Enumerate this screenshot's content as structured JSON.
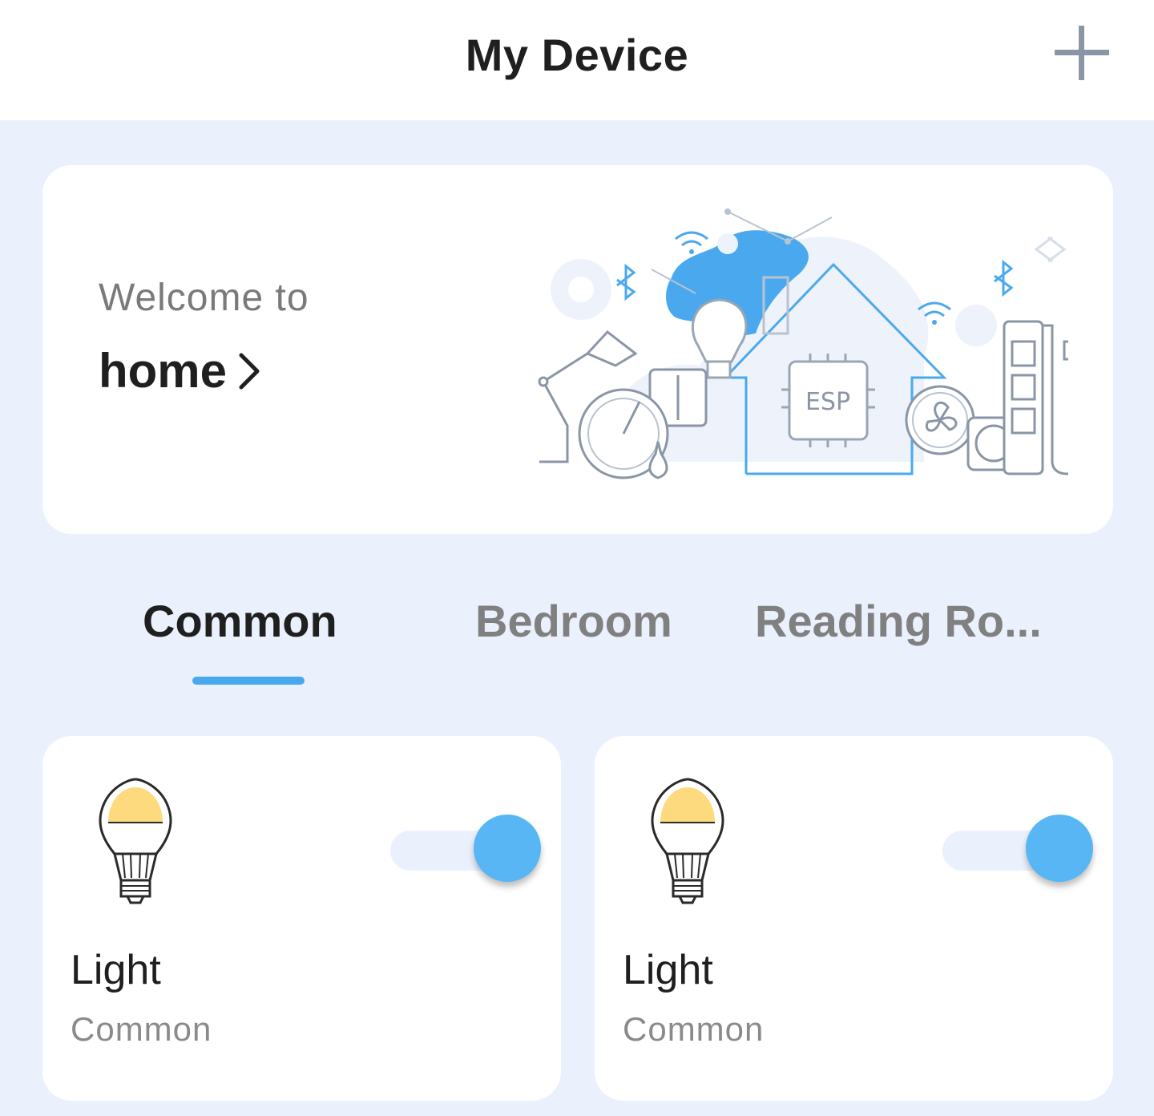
{
  "header": {
    "title": "My Device",
    "add_icon": "plus-icon"
  },
  "banner": {
    "welcome_text": "Welcome to",
    "home_label": "home",
    "chevron_icon": "chevron-right-icon",
    "illustration_label": "ESP"
  },
  "tabs": [
    {
      "label": "Common",
      "active": true
    },
    {
      "label": "Bedroom",
      "active": false
    },
    {
      "label": "Reading Ro...",
      "active": false
    }
  ],
  "devices": [
    {
      "name": "Light",
      "room": "Common",
      "icon": "light-bulb-icon",
      "on": true
    },
    {
      "name": "Light",
      "room": "Common",
      "icon": "light-bulb-icon",
      "on": true
    }
  ],
  "colors": {
    "accent": "#58B6F5",
    "page_background": "#EAF1FD",
    "bulb_glow": "#FDDA7E"
  }
}
